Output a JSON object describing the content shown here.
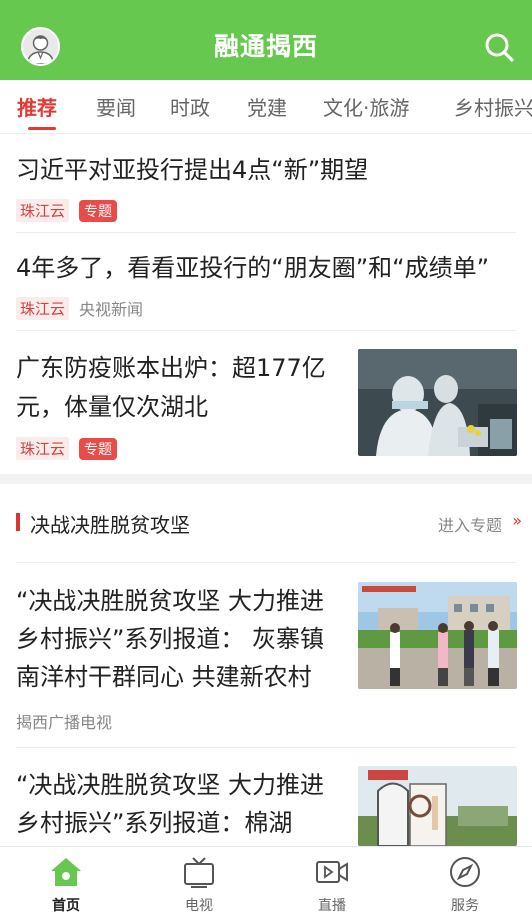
{
  "header": {
    "title": "融通揭西"
  },
  "tabs": [
    "推荐",
    "要闻",
    "时政",
    "党建",
    "文化·旅游",
    "乡村振兴"
  ],
  "news": [
    {
      "title": "习近平对亚投行提出4点“新”期望",
      "source": "珠江云",
      "tag": "专题"
    },
    {
      "title": "4年多了，看看亚投行的“朋友圈”和“成绩单”",
      "source": "珠江云",
      "extra": "央视新闻"
    },
    {
      "title": "广东防疫账本出炉：超177亿元，体量仅次湖北",
      "source": "珠江云",
      "tag": "专题"
    }
  ],
  "section": {
    "title": "决战决胜脱贫攻坚",
    "link": "进入专题",
    "chev": "»"
  },
  "section_news": [
    {
      "title": "“决战决胜脱贫攻坚 大力推进乡村振兴”系列报道： 灰寨镇南洋村干群同心 共建新农村",
      "source": "揭西广播电视"
    },
    {
      "title": "“决战决胜脱贫攻坚  大力推进乡村振兴”系列报道：棉湖"
    }
  ],
  "bottom_nav": [
    {
      "label": "首页",
      "icon": "home-icon"
    },
    {
      "label": "电视",
      "icon": "tv-icon"
    },
    {
      "label": "直播",
      "icon": "video-icon"
    },
    {
      "label": "服务",
      "icon": "compass-icon"
    }
  ],
  "colors": {
    "brand": "#66c84e",
    "accent": "#e33a35"
  }
}
